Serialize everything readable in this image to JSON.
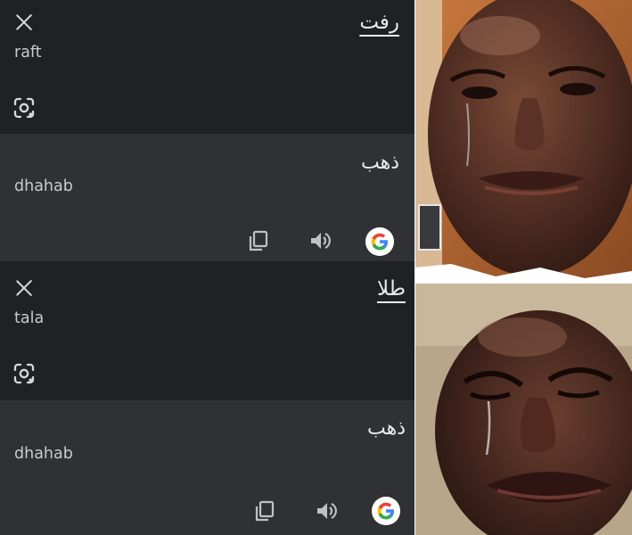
{
  "top": {
    "source_text": "رفت",
    "source_translit": "raft",
    "target_text": "ذهب",
    "target_translit": "dhahab"
  },
  "bottom": {
    "source_text": "طلا",
    "source_translit": "tala",
    "target_text": "ذهب",
    "target_translit": "dhahab"
  },
  "icons": [
    "close-icon",
    "camera-lens-icon",
    "copy-icon",
    "speaker-icon",
    "google-logo-icon"
  ],
  "colors": {
    "input_bg": "#202124",
    "output_bg": "#303134",
    "text": "#e8eaed",
    "muted_text": "#c9cacd"
  }
}
